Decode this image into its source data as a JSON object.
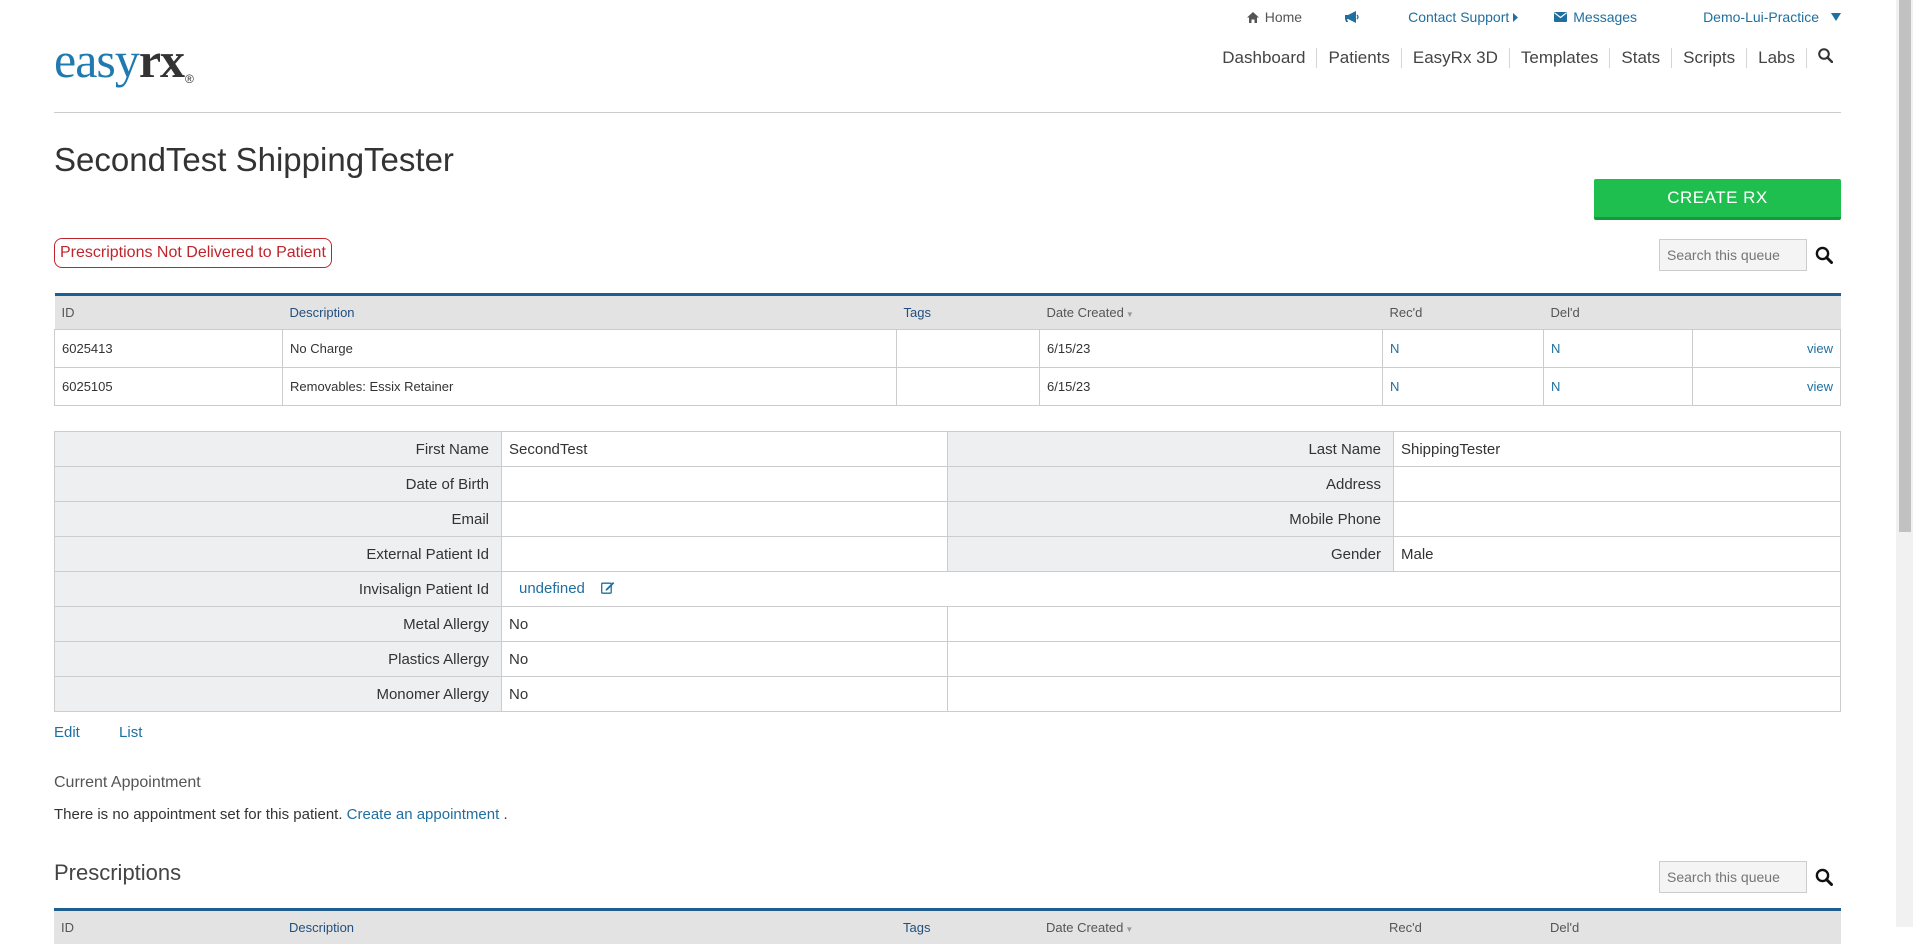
{
  "util": {
    "home": "Home",
    "contact": "Contact Support",
    "messages": "Messages",
    "practice": "Demo-Lui-Practice"
  },
  "logo": {
    "easy": "easy",
    "rx": "rx",
    "reg": "®"
  },
  "nav": [
    "Dashboard",
    "Patients",
    "EasyRx 3D",
    "Templates",
    "Stats",
    "Scripts",
    "Labs"
  ],
  "patient_name": "SecondTest ShippingTester",
  "create_rx": "CREATE RX",
  "alert": "Prescriptions Not Delivered to Patient",
  "search_placeholder": "Search this queue",
  "queue": {
    "headers": [
      "ID",
      "Description",
      "Tags",
      "Date Created",
      "Rec'd",
      "Del'd"
    ],
    "rows": [
      {
        "id": "6025413",
        "desc": "No Charge",
        "tags": "",
        "date": "6/15/23",
        "recd": "N",
        "deld": "N",
        "action": "view"
      },
      {
        "id": "6025105",
        "desc": "Removables: Essix Retainer",
        "tags": "",
        "date": "6/15/23",
        "recd": "N",
        "deld": "N",
        "action": "view"
      }
    ]
  },
  "details": {
    "first_name_label": "First Name",
    "first_name": "SecondTest",
    "last_name_label": "Last Name",
    "last_name": "ShippingTester",
    "dob_label": "Date of Birth",
    "dob": "",
    "address_label": "Address",
    "address": "",
    "email_label": "Email",
    "email": "",
    "mobile_label": "Mobile Phone",
    "mobile": "",
    "ext_id_label": "External Patient Id",
    "ext_id": "",
    "gender_label": "Gender",
    "gender": "Male",
    "invisalign_label": "Invisalign Patient Id",
    "invisalign": "undefined",
    "metal_label": "Metal Allergy",
    "metal": "No",
    "plastics_label": "Plastics Allergy",
    "plastics": "No",
    "monomer_label": "Monomer Allergy",
    "monomer": "No"
  },
  "links": {
    "edit": "Edit",
    "list": "List"
  },
  "appointment": {
    "title": "Current Appointment",
    "text": "There is no appointment set for this patient.",
    "link": "Create an appointment",
    "period": "."
  },
  "prescriptions": {
    "title": "Prescriptions",
    "headers": [
      "ID",
      "Description",
      "Tags",
      "Date Created",
      "Rec'd",
      "Del'd"
    ]
  }
}
